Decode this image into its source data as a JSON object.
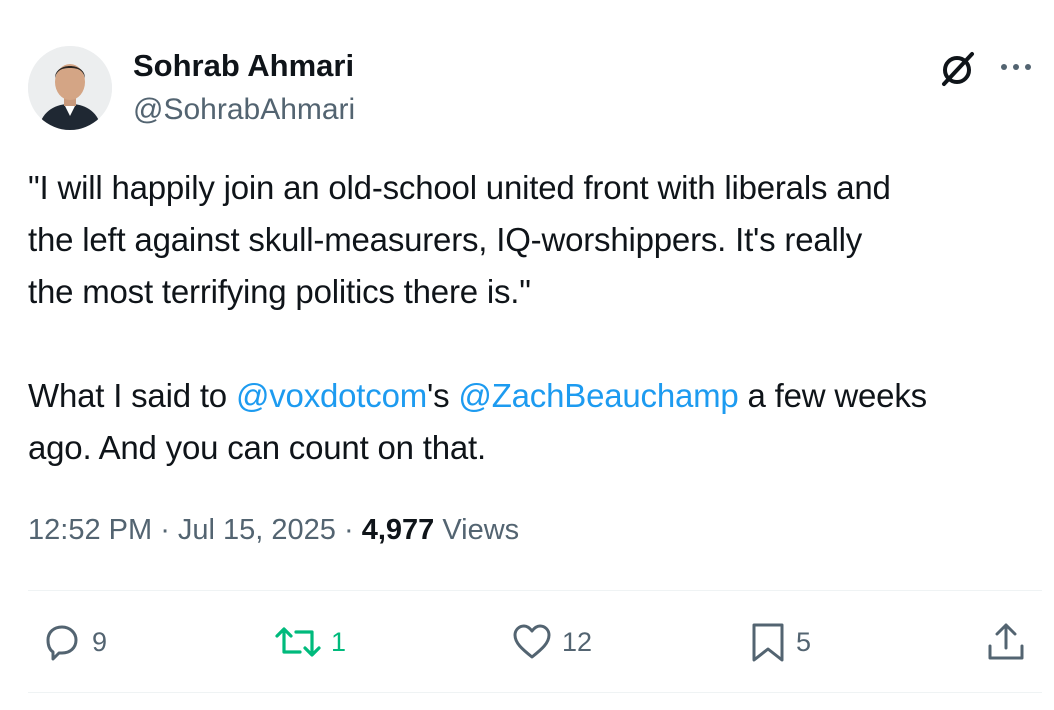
{
  "author": {
    "display_name": "Sohrab Ahmari",
    "handle": "@SohrabAhmari"
  },
  "header_icons": [
    "grok-icon",
    "more-icon"
  ],
  "tweet": {
    "line1": "\"I will happily join an old-school united front with liberals and",
    "line2": "the left against skull-measurers, IQ-worshippers. It's really",
    "line3": "the most terrifying politics there is.\"",
    "line4_pre": "What I said to ",
    "mention1": "@voxdotcom",
    "line4_mid": "'s ",
    "mention2": "@ZachBeauchamp",
    "line4_post": " a few weeks",
    "line5": "ago. And you can count on that."
  },
  "meta": {
    "time": "12:52 PM",
    "sep1": " · ",
    "date": "Jul 15, 2025",
    "sep2": " · ",
    "views_count": "4,977",
    "views_label": " Views"
  },
  "actions": {
    "reply": {
      "icon": "reply-icon",
      "count": "9"
    },
    "retweet": {
      "icon": "retweet-icon",
      "count": "1",
      "color": "#00ba7c"
    },
    "like": {
      "icon": "heart-icon",
      "count": "12"
    },
    "bookmark": {
      "icon": "bookmark-icon",
      "count": "5"
    },
    "share": {
      "icon": "share-icon"
    }
  },
  "colors": {
    "text": "#0f1419",
    "secondary": "#536471",
    "link": "#1d9bf0",
    "retweet_active": "#00ba7c"
  }
}
